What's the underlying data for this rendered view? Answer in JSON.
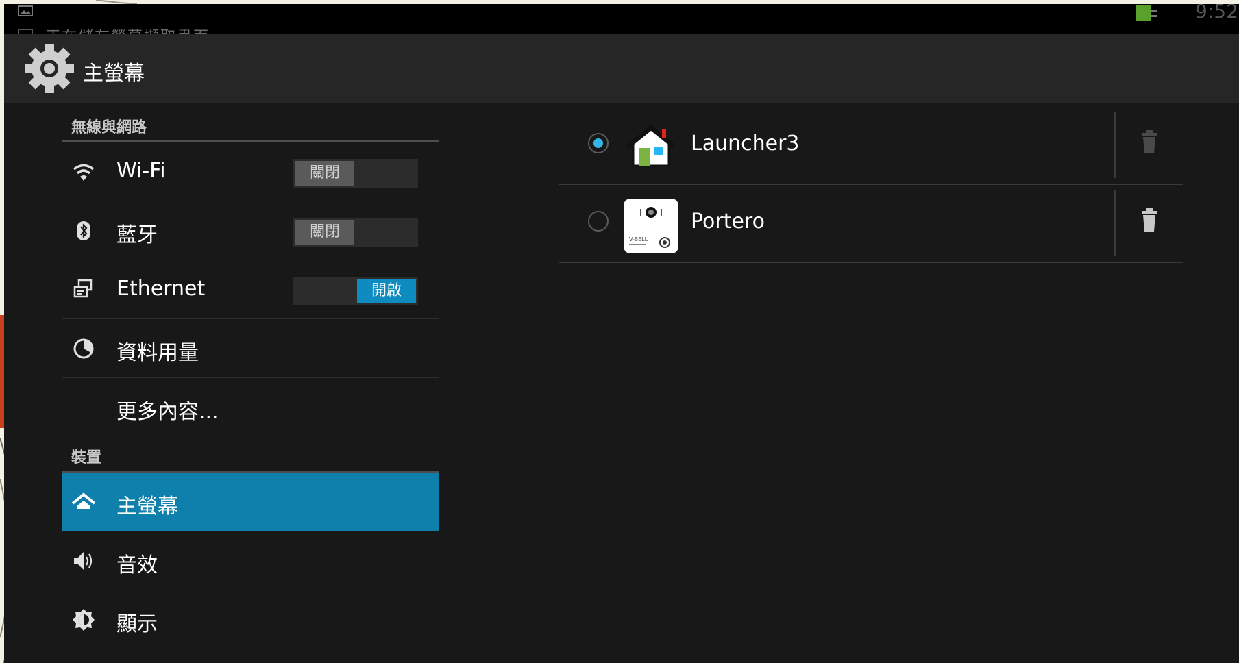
{
  "status_bar": {
    "notification_text": "正在儲存螢幕擷取畫面",
    "time": "9:52"
  },
  "action_bar": {
    "title": "主螢幕",
    "icon": "gear-icon"
  },
  "sidebar": {
    "sections": [
      {
        "header": "無線與網路",
        "items": [
          {
            "label": "Wi-Fi",
            "icon": "wifi-icon",
            "toggle": "關閉",
            "toggle_state": "off"
          },
          {
            "label": "藍牙",
            "icon": "bluetooth-icon",
            "toggle": "關閉",
            "toggle_state": "off"
          },
          {
            "label": "Ethernet",
            "icon": "ethernet-icon",
            "toggle": "開啟",
            "toggle_state": "on"
          },
          {
            "label": "資料用量",
            "icon": "data-usage-icon"
          },
          {
            "label": "更多內容..."
          }
        ]
      },
      {
        "header": "裝置",
        "items": [
          {
            "label": "主螢幕",
            "icon": "home-icon",
            "active": true
          },
          {
            "label": "音效",
            "icon": "speaker-icon"
          },
          {
            "label": "顯示",
            "icon": "brightness-icon"
          }
        ]
      }
    ]
  },
  "home_apps": [
    {
      "label": "Launcher3",
      "selected": true,
      "icon": "launcher3-app-icon",
      "delete_enabled": false
    },
    {
      "label": "Portero",
      "selected": false,
      "icon": "portero-app-icon",
      "icon_text": "V-BELL",
      "delete_enabled": true
    }
  ],
  "colors": {
    "accent": "#0f7fab",
    "radio_checked": "#33b5e5",
    "background": "#181818",
    "action_bar": "#262626"
  }
}
